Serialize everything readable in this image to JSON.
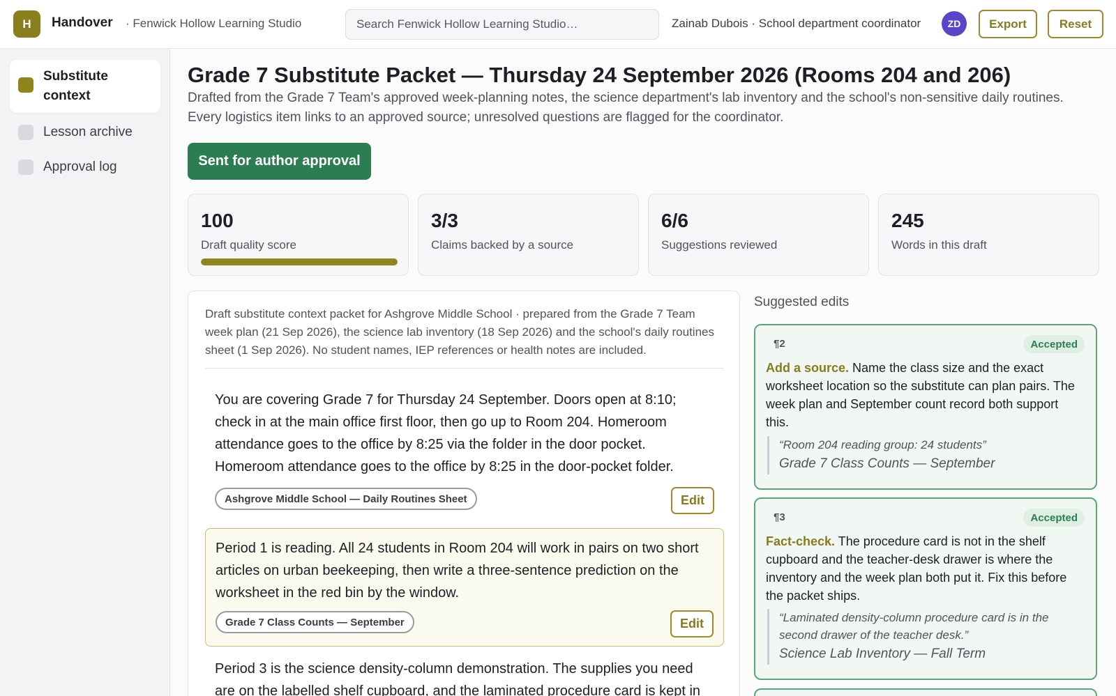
{
  "header": {
    "logo_letter": "H",
    "app_name": "Handover",
    "org_name": "· Fenwick Hollow Learning Studio",
    "search_placeholder": "Search Fenwick Hollow Learning Studio…",
    "user_info": "Zainab Dubois · School department coordinator",
    "avatar_initials": "ZD",
    "export_label": "Export",
    "reset_label": "Reset"
  },
  "sidebar": {
    "items": [
      {
        "label": "Substitute context",
        "active": true
      },
      {
        "label": "Lesson archive",
        "active": false
      },
      {
        "label": "Approval log",
        "active": false
      }
    ]
  },
  "main": {
    "title": "Grade 7 Substitute Packet — Thursday 24 September 2026 (Rooms 204 and 206)",
    "subtitle": "Drafted from the Grade 7 Team's approved week-planning notes, the science department's lab inventory and the school's non-sensitive daily routines. Every logistics item links to an approved source; unresolved questions are flagged for the coordinator.",
    "status_button": "Sent for author approval"
  },
  "stats": [
    {
      "value": "100",
      "caption": "Draft quality score",
      "progress": 1.0
    },
    {
      "value": "3/3",
      "caption": "Claims backed by a source"
    },
    {
      "value": "6/6",
      "caption": "Suggestions reviewed"
    },
    {
      "value": "245",
      "caption": "Words in this draft"
    }
  ],
  "draft": {
    "intro": "Draft substitute context packet for Ashgrove Middle School · prepared from the Grade 7 Team week plan (21 Sep 2026), the science lab inventory (18 Sep 2026) and the school's daily routines sheet (1 Sep 2026). No student names, IEP references or health notes are included.",
    "paragraphs": [
      {
        "text": "You are covering Grade 7 for Thursday 24 September. Doors open at 8:10; check in at the main office first floor, then go up to Room 204. Homeroom attendance goes to the office by 8:25 via the folder in the door pocket. Homeroom attendance goes to the office by 8:25 in the door-pocket folder.",
        "source": "Ashgrove Middle School — Daily Routines Sheet",
        "edit_label": "Edit"
      },
      {
        "text": "Period 1 is reading. All 24 students in Room 204 will work in pairs on two short articles on urban beekeeping, then write a three-sentence prediction on the worksheet in the red bin by the window.",
        "source": "Grade 7 Class Counts — September",
        "edit_label": "Edit"
      },
      {
        "text": "Period 3 is the science density-column demonstration. The supplies you need are on the labelled shelf cupboard, and the laminated procedure card is kept in"
      }
    ]
  },
  "suggestions": {
    "heading": "Suggested edits",
    "items": [
      {
        "para": "¶2",
        "status": "Accepted",
        "kind": "Add a source.",
        "text": "Name the class size and the exact worksheet location so the substitute can plan pairs. The week plan and September count record both support this.",
        "quote": "“Room 204 reading group: 24 students”",
        "quote_source": "Grade 7 Class Counts — September"
      },
      {
        "para": "¶3",
        "status": "Accepted",
        "kind": "Fact-check.",
        "text": "The procedure card is not in the shelf cupboard and the teacher-desk drawer is where the inventory and the week plan both put it. Fix this before the packet ships.",
        "quote": "“Laminated density-column procedure card is in the second drawer of the teacher desk.”",
        "quote_source": "Science Lab Inventory — Fall Term"
      }
    ]
  },
  "colors": {
    "accent": "#8f851f",
    "success": "#2d7d52",
    "avatar": "#5b45c9"
  }
}
